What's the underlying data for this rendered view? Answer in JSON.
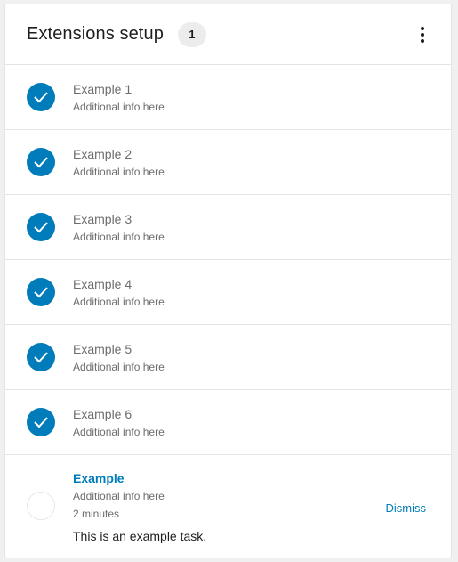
{
  "header": {
    "title": "Extensions setup",
    "badge_count": "1",
    "menu_icon": "vertical-ellipsis-icon"
  },
  "completed_items": [
    {
      "title": "Example 1",
      "subtitle": "Additional info here"
    },
    {
      "title": "Example 2",
      "subtitle": "Additional info here"
    },
    {
      "title": "Example 3",
      "subtitle": "Additional info here"
    },
    {
      "title": "Example 4",
      "subtitle": "Additional info here"
    },
    {
      "title": "Example 5",
      "subtitle": "Additional info here"
    },
    {
      "title": "Example 6",
      "subtitle": "Additional info here"
    }
  ],
  "active_item": {
    "title": "Example",
    "subtitle": "Additional info here",
    "time": "2 minutes",
    "description": "This is an example task.",
    "dismiss_label": "Dismiss"
  },
  "colors": {
    "accent": "#007cba",
    "border": "#e2e4e7",
    "text_muted": "#6c6c6c",
    "text_dark": "#1e1e1e"
  }
}
